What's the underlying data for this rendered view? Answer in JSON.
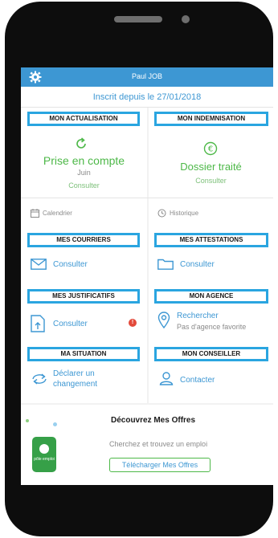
{
  "header": {
    "user_name": "Paul JOB"
  },
  "banner_top": {
    "inscrit": "Inscrit depuis le 27/01/2018"
  },
  "actualisation": {
    "title": "MON ACTUALISATION",
    "status": "Prise en compte",
    "month": "Juin",
    "link": "Consulter"
  },
  "indemnisation": {
    "title": "MON INDEMNISATION",
    "status": "Dossier traité",
    "link": "Consulter"
  },
  "calendrier": {
    "label": "Calendrier"
  },
  "historique": {
    "label": "Historique"
  },
  "courriers": {
    "title": "MES COURRIERS",
    "link": "Consulter"
  },
  "attestations": {
    "title": "MES ATTESTATIONS",
    "link": "Consulter"
  },
  "justificatifs": {
    "title": "MES JUSTIFICATIFS",
    "link": "Consulter",
    "badge": "!"
  },
  "agence": {
    "title": "MON AGENCE",
    "link": "Rechercher",
    "sub": "Pas d'agence favorite"
  },
  "situation": {
    "title": "MA SITUATION",
    "link_line1": "Déclarer un",
    "link_line2": "changement"
  },
  "conseiller": {
    "title": "MON CONSEILLER",
    "link": "Contacter"
  },
  "offres": {
    "title": "Découvrez Mes Offres",
    "subtitle": "Cherchez et trouvez un emploi",
    "button": "Télécharger Mes Offres",
    "app_label": "pôle emploi"
  },
  "colors": {
    "accent": "#3d97d3",
    "highlight": "#2aa5e0",
    "green": "#4db848",
    "badge": "#e34a3b"
  }
}
